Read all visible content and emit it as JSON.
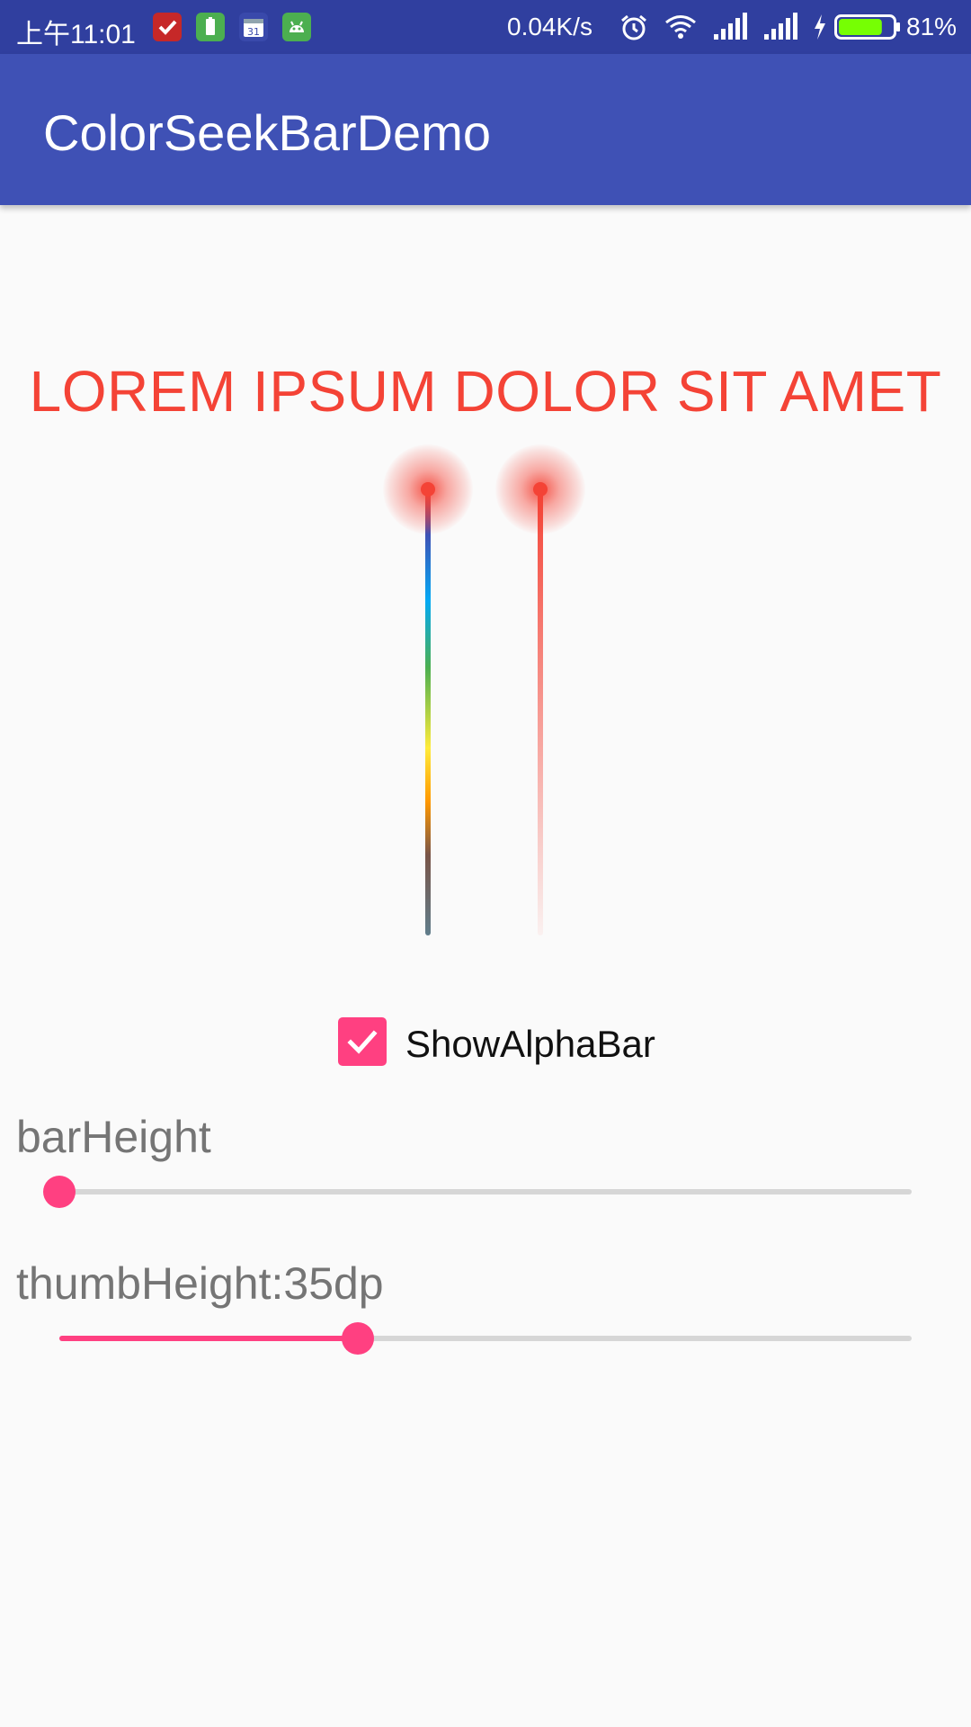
{
  "status_bar": {
    "time": "上午11:01",
    "network_speed": "0.04K/s",
    "battery_percent": "81%",
    "battery_level": 0.81,
    "icons": [
      "tasks-app-icon",
      "battery-app-icon",
      "calendar-app-icon",
      "android-app-icon",
      "alarm-icon",
      "wifi-icon",
      "signal-icon",
      "signal-icon",
      "charging-icon",
      "battery-icon"
    ],
    "calendar_day": "31"
  },
  "app_bar": {
    "title": "ColorSeekBarDemo"
  },
  "preview": {
    "text": "LOREM IPSUM DOLOR SIT AMET",
    "color": "#f44336"
  },
  "color_bar": {
    "colors": [
      "#f44336",
      "#3f51b5",
      "#03a9f4",
      "#4caf50",
      "#ffeb3b",
      "#ff9800",
      "#795548",
      "#607d8b"
    ],
    "thumb_position": 0.0
  },
  "alpha_bar": {
    "thumb_position": 0.0
  },
  "show_alpha_bar": {
    "label": "ShowAlphaBar",
    "checked": true
  },
  "bar_height": {
    "label": "barHeight",
    "value": 0.0
  },
  "thumb_height": {
    "label": "thumbHeight:35dp",
    "value": 0.35
  },
  "accent_color": "#ff4081",
  "primary_color": "#3f51b5"
}
